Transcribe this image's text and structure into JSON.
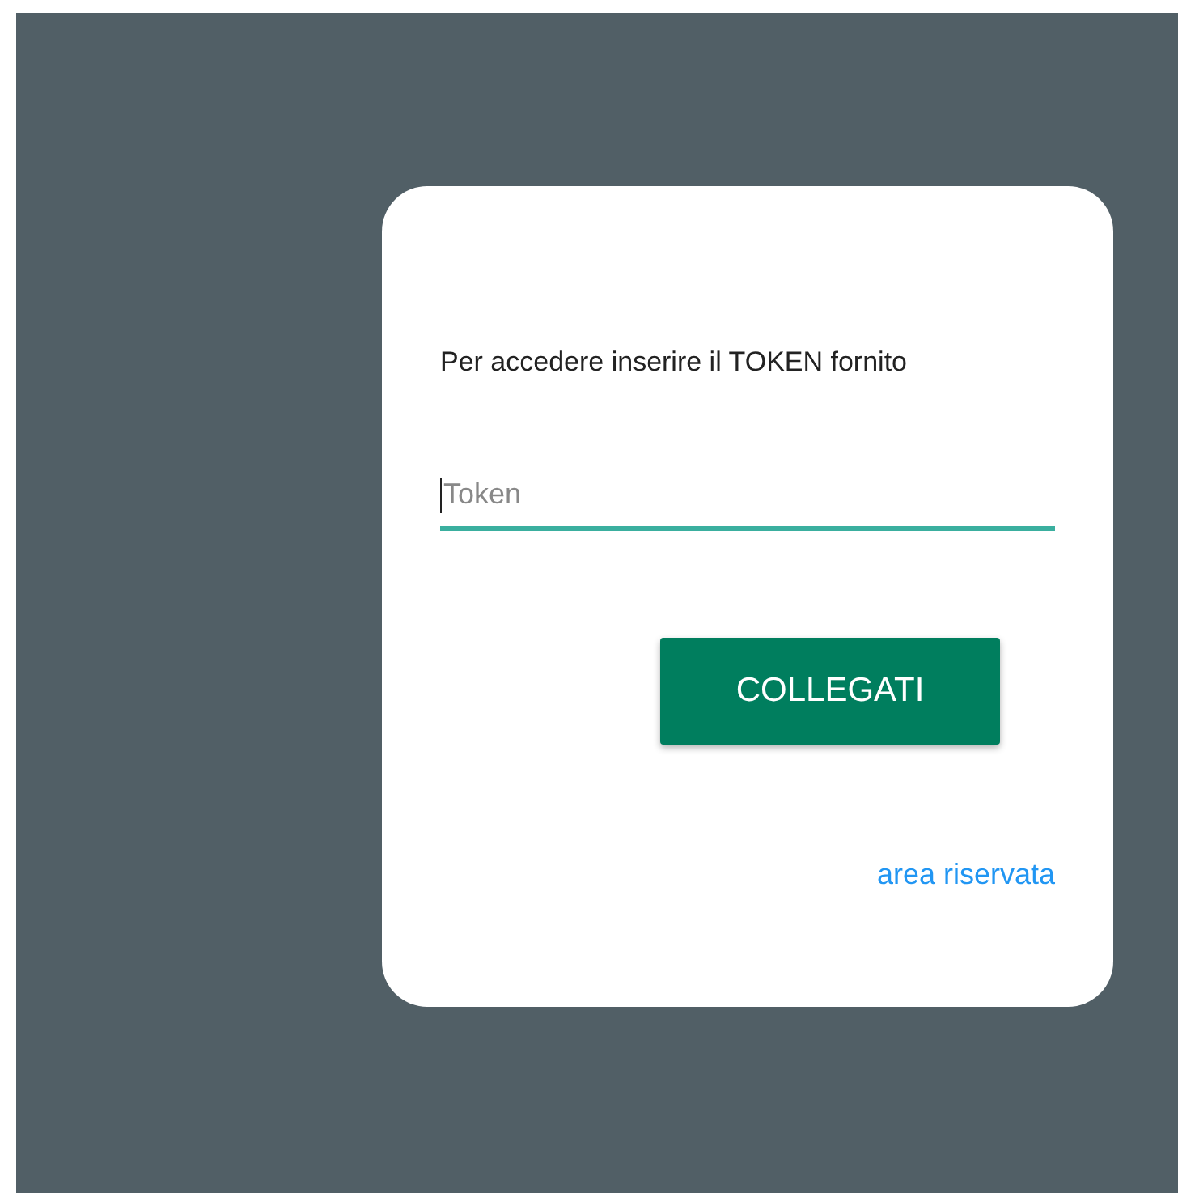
{
  "prompt": "Per accedere inserire il TOKEN fornito",
  "token_field": {
    "placeholder": "Token",
    "focused": true
  },
  "connect_button": "COLLEGATI",
  "link": "area riservata"
}
